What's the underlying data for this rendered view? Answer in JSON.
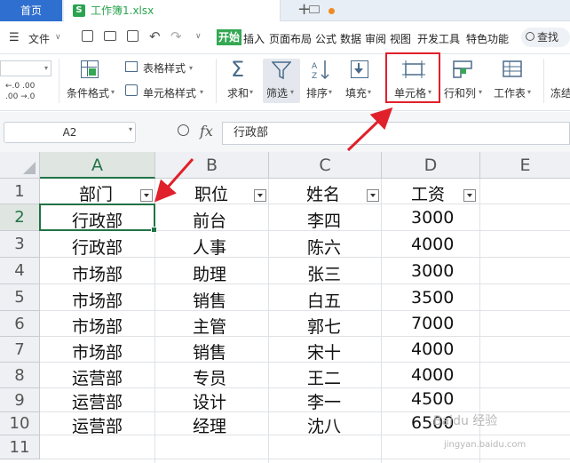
{
  "titlebar": {
    "home_tab": "首页",
    "file_tab": "工作簿1.xlsx",
    "file_icon_letter": "S"
  },
  "menu": {
    "file": "文件",
    "items": [
      "开始",
      "插入",
      "页面布局",
      "公式",
      "数据",
      "审阅",
      "视图",
      "开发工具",
      "特色功能"
    ],
    "search": "查找"
  },
  "ribbon": {
    "cond_format": "条件格式",
    "table_style": "表格样式",
    "cell_style": "单元格样式",
    "sum": "求和",
    "filter": "筛选",
    "sort": "排序",
    "fill": "填充",
    "cell": "单元格",
    "row_col": "行和列",
    "worksheet": "工作表",
    "freeze": "冻结",
    "dec_inc": "←.0 .00",
    "dec_dec": ".00 →.0"
  },
  "formula": {
    "name_box": "A2",
    "fx_label": "fx",
    "content": "行政部"
  },
  "grid": {
    "columns": [
      "A",
      "B",
      "C",
      "D",
      "E"
    ],
    "rows": [
      "1",
      "2",
      "3",
      "4",
      "5",
      "6",
      "7",
      "8",
      "9",
      "10",
      "11"
    ],
    "headers": [
      "部门",
      "职位",
      "姓名",
      "工资"
    ],
    "data": [
      [
        "行政部",
        "前台",
        "李四",
        "3000"
      ],
      [
        "行政部",
        "人事",
        "陈六",
        "4000"
      ],
      [
        "市场部",
        "助理",
        "张三",
        "3000"
      ],
      [
        "市场部",
        "销售",
        "白五",
        "3500"
      ],
      [
        "市场部",
        "主管",
        "郭七",
        "7000"
      ],
      [
        "市场部",
        "销售",
        "宋十",
        "4000"
      ],
      [
        "运营部",
        "专员",
        "王二",
        "4000"
      ],
      [
        "运营部",
        "设计",
        "李一",
        "4500"
      ],
      [
        "运营部",
        "经理",
        "沈八",
        "6500"
      ]
    ]
  },
  "watermark": {
    "line1": "Baidu 经验",
    "line2": "jingyan.baidu.com"
  },
  "colors": {
    "accent_green": "#217346",
    "annotation_red": "#e0202a",
    "home_tab_blue": "#2f6fcf"
  }
}
